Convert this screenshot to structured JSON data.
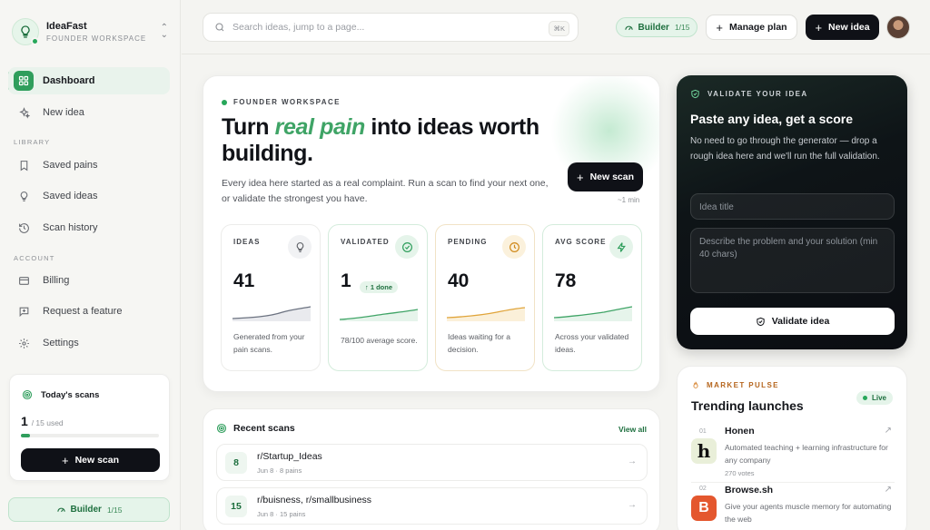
{
  "workspace": {
    "name": "IdeaFast",
    "subtitle": "FOUNDER WORKSPACE"
  },
  "nav": {
    "dashboard": "Dashboard",
    "new_idea": "New idea",
    "library_label": "LIBRARY",
    "saved_pains": "Saved pains",
    "saved_ideas": "Saved ideas",
    "scan_history": "Scan history",
    "account_label": "ACCOUNT",
    "billing": "Billing",
    "request_feature": "Request a feature",
    "settings": "Settings"
  },
  "todays_scans": {
    "title": "Today's scans",
    "used": "1",
    "limit": "/ 15 used",
    "progress": 0.067,
    "button": "New scan"
  },
  "plan": {
    "name": "Builder",
    "usage": "1/15"
  },
  "topbar": {
    "search_placeholder": "Search ideas, jump to a page...",
    "shortcut": "⌘K",
    "manage_plan": "Manage plan",
    "new_idea": "New idea"
  },
  "hero": {
    "eyebrow": "FOUNDER WORKSPACE",
    "title_pre": "Turn ",
    "title_em": "real pain",
    "title_post": " into ideas worth building.",
    "description": "Every idea here started as a real complaint. Run a scan to find your next one, or validate the strongest you have.",
    "scan_button": "New scan",
    "eta": "~1 min"
  },
  "stats": [
    {
      "label": "IDEAS",
      "value": "41",
      "note": "Generated from your pain scans.",
      "color": "#6b7280",
      "icon": "lightbulb-icon"
    },
    {
      "label": "VALIDATED",
      "value": "1",
      "change": "↑ 1 done",
      "note": "78/100 average score.",
      "color": "#3fa466",
      "icon": "check-circle-icon"
    },
    {
      "label": "PENDING",
      "value": "40",
      "note": "Ideas waiting for a decision.",
      "color": "#e0a43a",
      "icon": "clock-icon"
    },
    {
      "label": "AVG SCORE",
      "value": "78",
      "note": "Across your validated ideas.",
      "color": "#3fa466",
      "icon": "bolt-icon"
    }
  ],
  "recent_scans": {
    "title": "Recent scans",
    "view_all": "View all",
    "items": [
      {
        "count": "8",
        "subreddits": "r/Startup_Ideas",
        "meta": "Jun 8 · 8 pains"
      },
      {
        "count": "15",
        "subreddits": "r/buisness, r/smallbusiness",
        "meta": "Jun 8 · 15 pains"
      }
    ]
  },
  "validate": {
    "eyebrow": "VALIDATE YOUR IDEA",
    "title": "Paste any idea, get a score",
    "description": "No need to go through the generator — drop a rough idea here and we'll run the full validation.",
    "title_placeholder": "Idea title",
    "desc_placeholder": "Describe the problem and your solution (min 40 chars)",
    "button": "Validate idea"
  },
  "market_pulse": {
    "eyebrow": "MARKET PULSE",
    "title": "Trending launches",
    "live": "Live",
    "launches": [
      {
        "rank": "01",
        "name": "Honen",
        "description": "Automated teaching + learning infrastructure for any company",
        "votes": "270 votes",
        "logo_letter": "h"
      },
      {
        "rank": "02",
        "name": "Browse.sh",
        "description": "Give your agents muscle memory for automating the web",
        "logo_letter": "B"
      }
    ]
  },
  "colors": {
    "accent": "#2f9e5c",
    "dark": "#0f1117",
    "pending": "#e0a43a"
  }
}
